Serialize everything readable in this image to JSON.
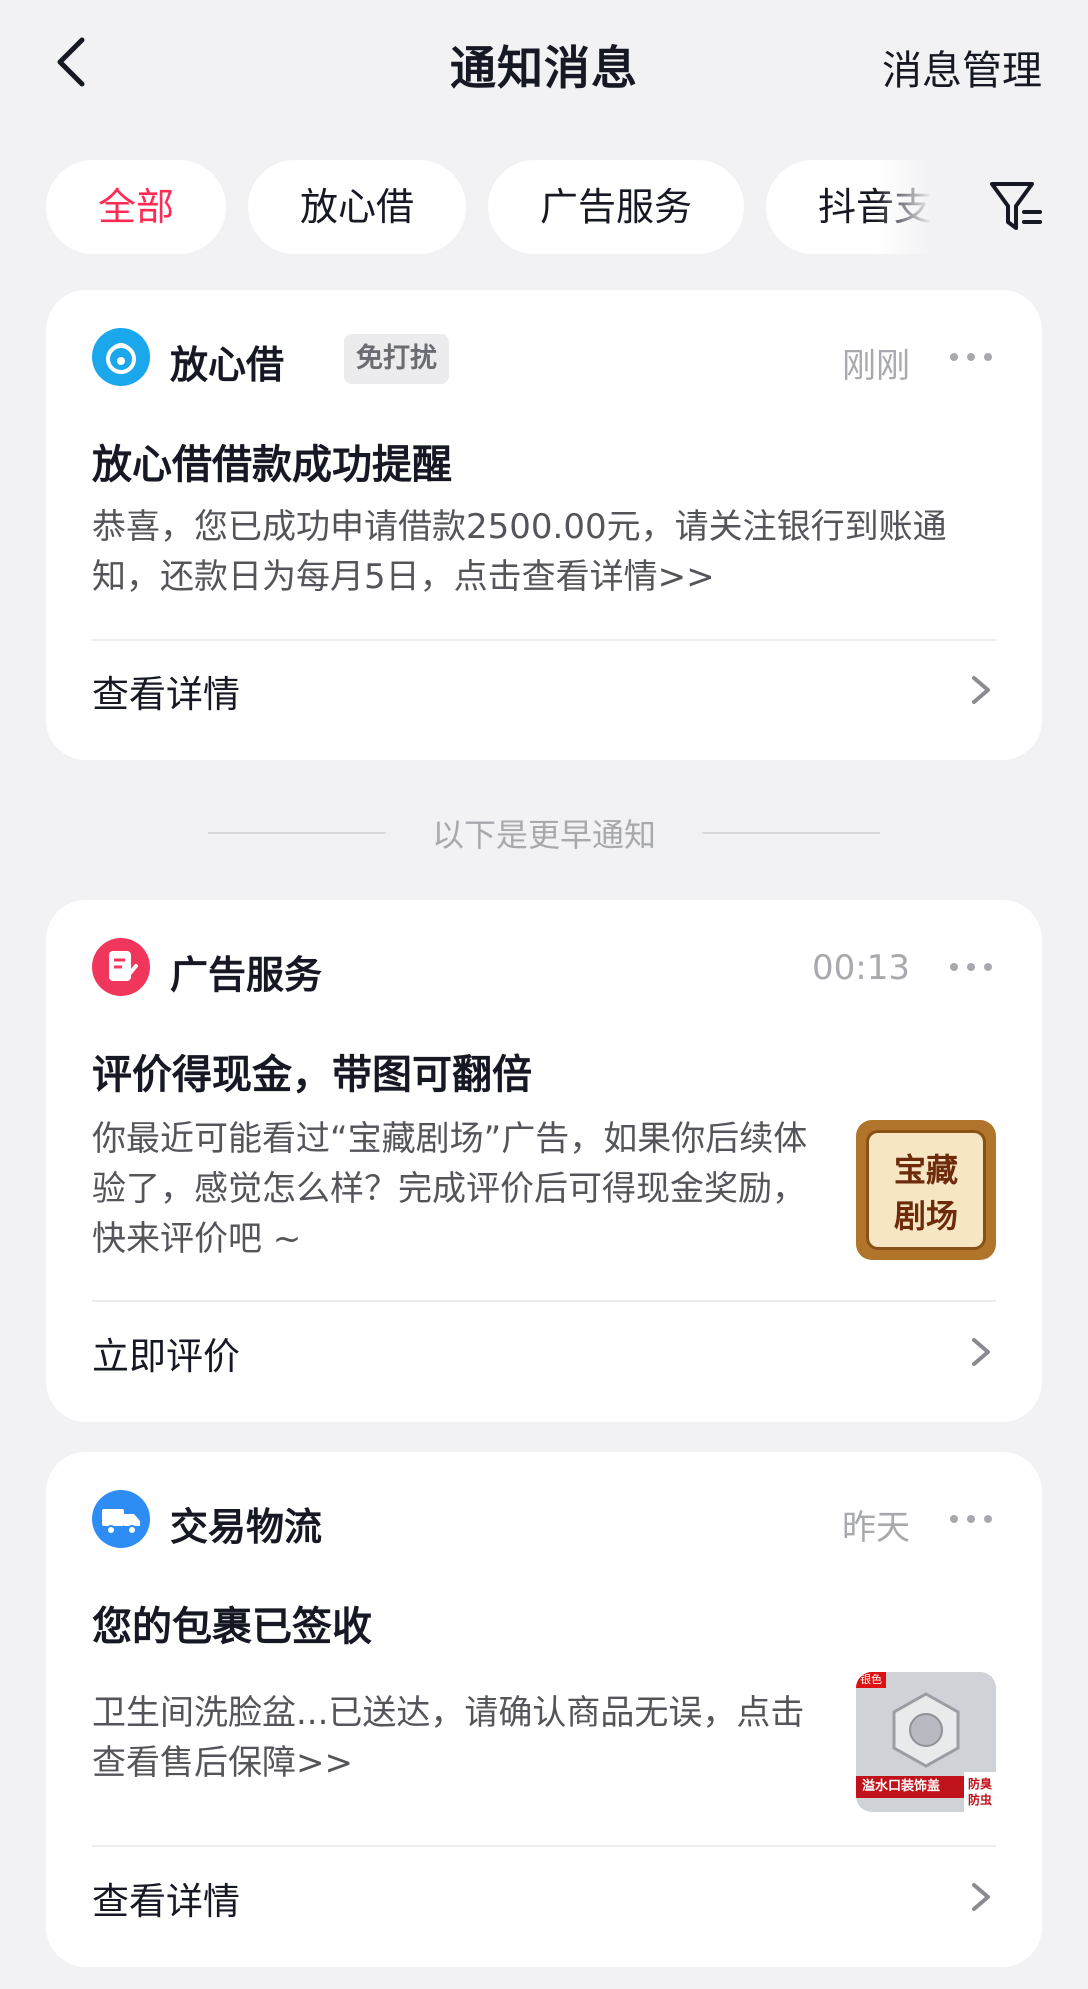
{
  "header": {
    "title": "通知消息",
    "manage_label": "消息管理"
  },
  "tabs": [
    {
      "label": "全部",
      "active": true
    },
    {
      "label": "放心借",
      "active": false
    },
    {
      "label": "广告服务",
      "active": false
    },
    {
      "label": "抖音支",
      "active": false
    }
  ],
  "cards": [
    {
      "source": "放心借",
      "badge": "免打扰",
      "time": "刚刚",
      "title": "放心借借款成功提醒",
      "body": "恭喜，您已成功申请借款2500.00元，请关注银行到账通知，还款日为每月5日，点击查看详情>>",
      "action": "查看详情",
      "icon": "fangxinjie-icon"
    },
    {
      "source": "广告服务",
      "time": "00:13",
      "title": "评价得现金，带图可翻倍",
      "body": "你最近可能看过“宝藏剧场”广告，如果你后续体验了，感觉怎么样？完成评价后可得现金奖励，快来评价吧 ~",
      "action": "立即评价",
      "icon": "ad-service-icon",
      "thumb_text": [
        "宝藏",
        "剧场"
      ]
    },
    {
      "source": "交易物流",
      "time": "昨天",
      "title": "您的包裹已签收",
      "body": "卫生间洗脸盆...已送达，请确认商品无误，点击查看售后保障>>",
      "action": "查看详情",
      "icon": "delivery-truck-icon",
      "thumb_tag": "银色",
      "thumb_caption": "溢水口装饰盖",
      "thumb_corner": [
        "防臭",
        "防虫"
      ]
    }
  ],
  "separator": {
    "label": "以下是更早通知"
  },
  "colors": {
    "accent": "#fe2c55",
    "background": "#f2f2f4",
    "card": "#ffffff",
    "fangxinjie": "#1aa7ec",
    "ad_service": "#f0365a",
    "logistics": "#2e8df5"
  }
}
